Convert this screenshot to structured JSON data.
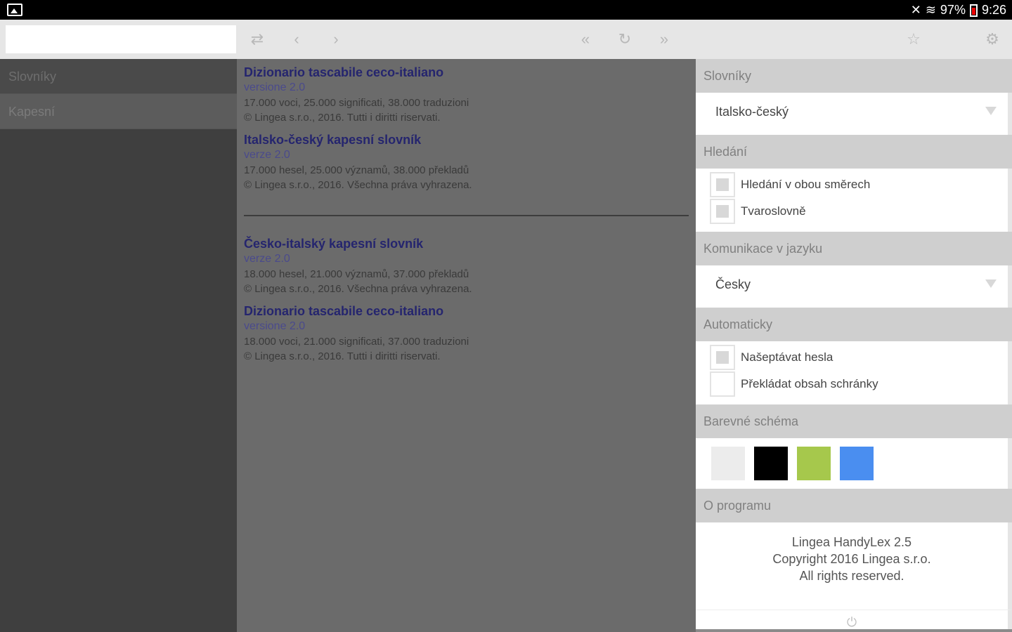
{
  "statusbar": {
    "battery": "97%",
    "time": "9:26"
  },
  "search": {
    "value": "",
    "placeholder": ""
  },
  "sidebar": {
    "items": [
      {
        "label": "Slovníky"
      },
      {
        "label": "Kapesní"
      }
    ]
  },
  "main": {
    "entries": [
      {
        "title": "Dizionario tascabile ceco-italiano",
        "version": "versione 2.0",
        "stats": "17.000 voci, 25.000 significati, 38.000 traduzioni",
        "copyright": "© Lingea s.r.o., 2016. Tutti i diritti riservati."
      },
      {
        "title": "Italsko-český kapesní slovník",
        "version": "verze 2.0",
        "stats": "17.000 hesel, 25.000 významů, 38.000 překladů",
        "copyright": "© Lingea s.r.o., 2016. Všechna práva vyhrazena."
      },
      {
        "title": "Česko-italský kapesní slovník",
        "version": "verze 2.0",
        "stats": "18.000 hesel, 21.000 významů, 37.000 překladů",
        "copyright": "© Lingea s.r.o., 2016. Všechna práva vyhrazena."
      },
      {
        "title": "Dizionario tascabile ceco-italiano",
        "version": "versione 2.0",
        "stats": "18.000 voci, 21.000 significati, 37.000 traduzioni",
        "copyright": "© Lingea s.r.o., 2016. Tutti i diritti riservati."
      }
    ]
  },
  "settings": {
    "dictionaries": {
      "header": "Slovníky",
      "selected": "Italsko-český"
    },
    "search": {
      "header": "Hledání",
      "both_directions": "Hledání v obou směrech",
      "morphology": "Tvaroslovně"
    },
    "language": {
      "header": "Komunikace v jazyku",
      "selected": "Česky"
    },
    "automatic": {
      "header": "Automaticky",
      "suggest": "Našeptávat hesla",
      "clipboard": "Překládat obsah schránky"
    },
    "color_scheme": {
      "header": "Barevné schéma",
      "colors": [
        "#ececec",
        "#000000",
        "#a6c84c",
        "#4a8ef0"
      ]
    },
    "about": {
      "header": "O programu",
      "line1": "Lingea HandyLex 2.5",
      "line2": "Copyright 2016 Lingea s.r.o.",
      "line3": "All rights reserved."
    }
  }
}
